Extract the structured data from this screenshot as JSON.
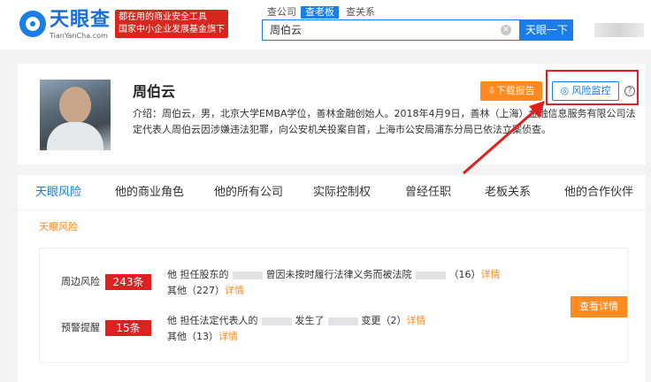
{
  "header": {
    "logo_name": "天眼查",
    "logo_domain": "TianYanCha.com",
    "slogan_line1": "都在用的商业安全工具",
    "slogan_line2": "国家中小企业发展基金旗下",
    "search_tabs": [
      "查公司",
      "查老板",
      "查关系"
    ],
    "search_value": "周伯云",
    "search_button": "天眼一下"
  },
  "profile": {
    "name": "周伯云",
    "intro": "介绍：周伯云，男，北京大学EMBA学位，善林金融创始人。2018年4月9日，善林（上海）金融信息服务有限公司法定代表人周伯云因涉嫌违法犯罪，向公安机关投案自首，上海市公安局浦东分局已依法立案侦查。",
    "download_button": "下载报告",
    "monitor_button": "风险监控",
    "help_symbol": "?"
  },
  "tabs": [
    "天眼风险",
    "他的商业角色",
    "他的所有公司",
    "实际控制权",
    "曾经任职",
    "老板关系",
    "他的合作伙伴"
  ],
  "risk_section": {
    "title": "天眼风险",
    "rows": [
      {
        "label": "周边风险",
        "count": "243条",
        "line1_prefix": "他 担任股东的",
        "line1_mid": "曾因未按时履行法律义务而被法院",
        "line1_count": "（16）",
        "line2": "其他（227）",
        "link": "详情"
      },
      {
        "label": "预警提醒",
        "count": "15条",
        "line1_prefix": "他 担任法定代表人的",
        "line1_mid": "发生了",
        "line1_suffix": "变更（2）",
        "line2": "其他（13）",
        "link": "详情"
      }
    ],
    "detail_button": "查看详情"
  },
  "colors": {
    "brand_blue": "#1a7ee6",
    "accent_orange": "#ff8a1f",
    "alert_red": "#e02020"
  }
}
